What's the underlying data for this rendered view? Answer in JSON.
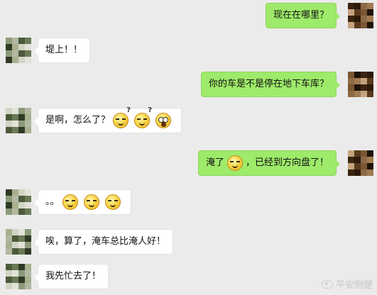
{
  "messages": [
    {
      "side": "right",
      "parts": [
        {
          "type": "text",
          "value": "现在在哪里？"
        }
      ]
    },
    {
      "side": "left",
      "parts": [
        {
          "type": "text",
          "value": "堤上！！"
        }
      ]
    },
    {
      "side": "right",
      "parts": [
        {
          "type": "text",
          "value": "你的车是不是停在地下车库？"
        }
      ]
    },
    {
      "side": "left",
      "parts": [
        {
          "type": "text",
          "value": "是啊，怎么了？"
        },
        {
          "type": "emoji",
          "name": "confused-emoji"
        },
        {
          "type": "emoji",
          "name": "confused-emoji"
        },
        {
          "type": "emoji",
          "name": "shocked-emoji"
        }
      ]
    },
    {
      "side": "right",
      "parts": [
        {
          "type": "text",
          "value": "淹了"
        },
        {
          "type": "emoji",
          "name": "squint-emoji"
        },
        {
          "type": "text",
          "value": "，已经到方向盘了！"
        }
      ]
    },
    {
      "side": "left",
      "parts": [
        {
          "type": "text",
          "value": "。。"
        },
        {
          "type": "emoji",
          "name": "squint-emoji"
        },
        {
          "type": "emoji",
          "name": "squint-emoji"
        },
        {
          "type": "emoji",
          "name": "laughing-emoji"
        }
      ]
    },
    {
      "side": "left",
      "parts": [
        {
          "type": "text",
          "value": "唉，算了，淹车总比淹人好！"
        }
      ]
    },
    {
      "side": "left",
      "parts": [
        {
          "type": "text",
          "value": "我先忙去了！"
        }
      ]
    }
  ],
  "watermark": {
    "text": "平安荆楚",
    "icon": "weibo-icon"
  },
  "colors": {
    "background": "#ebebeb",
    "left_bubble": "#ffffff",
    "right_bubble": "#9eea6a"
  }
}
